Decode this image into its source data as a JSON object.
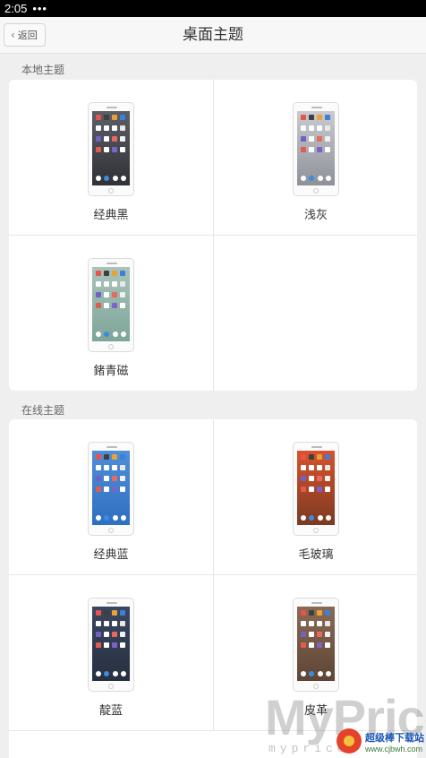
{
  "status_bar": {
    "time": "2:05",
    "dots": "•••"
  },
  "header": {
    "back_label": "返回",
    "title": "桌面主题"
  },
  "sections": [
    {
      "label": "本地主题",
      "themes": [
        {
          "name": "经典黑",
          "bg": [
            "#5c5f66",
            "#2f3136"
          ]
        },
        {
          "name": "浅灰",
          "bg": [
            "#c9cbd0",
            "#8e9198"
          ]
        },
        {
          "name": "鍺青磁",
          "bg": [
            "#a9c4bb",
            "#7fa598"
          ]
        }
      ]
    },
    {
      "label": "在线主题",
      "themes": [
        {
          "name": "经典蓝",
          "bg": [
            "#4f8fd8",
            "#2f6fc0"
          ]
        },
        {
          "name": "毛玻璃",
          "bg": [
            "#d9532c",
            "#7a3a22"
          ]
        },
        {
          "name": "靛蓝",
          "bg": [
            "#3b4760",
            "#27303f"
          ]
        },
        {
          "name": "皮革",
          "bg": [
            "#8a6a55",
            "#5e4535"
          ]
        }
      ]
    }
  ],
  "watermark": {
    "text": "MyPrice",
    "sub": "myprice",
    "site_name": "超级棒下载站",
    "site_url": "www.cjbwh.com"
  }
}
